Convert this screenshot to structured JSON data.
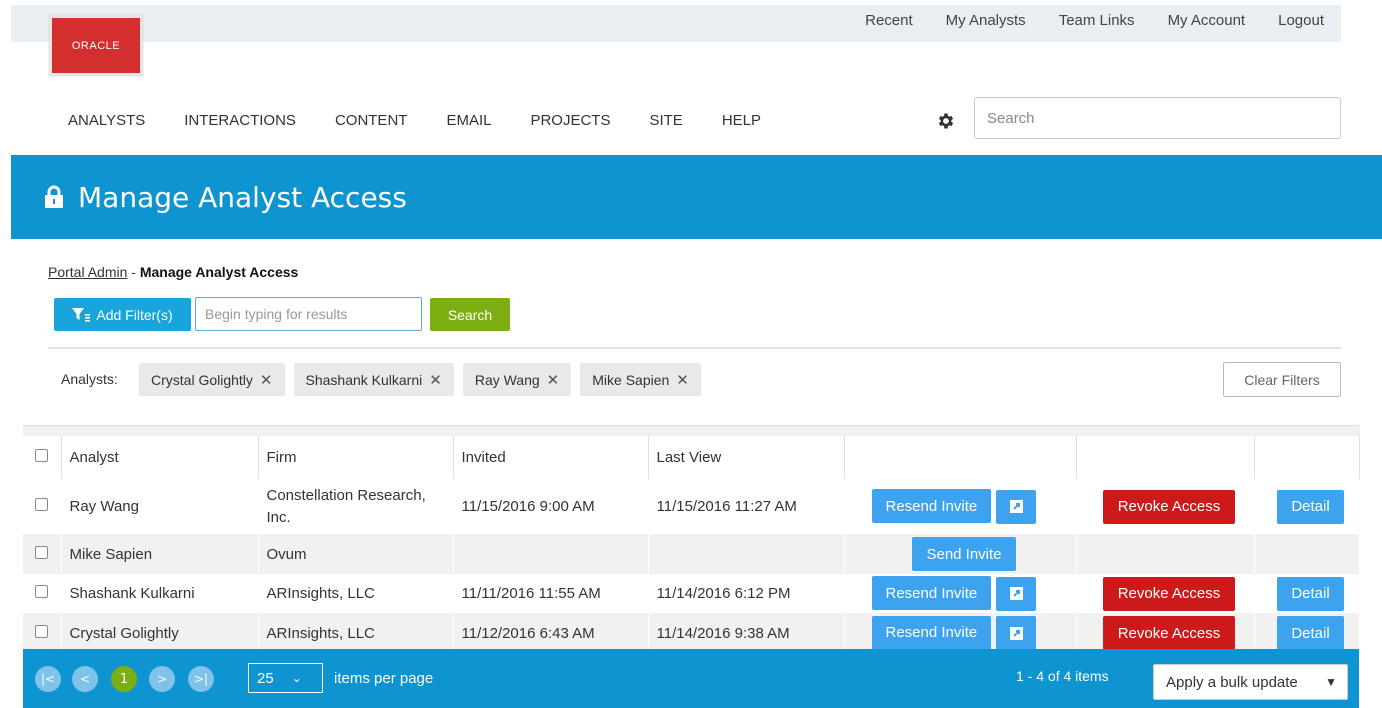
{
  "header": {
    "logo_text": "ORACLE",
    "top_links": [
      "Recent",
      "My Analysts",
      "Team Links",
      "My Account",
      "Logout"
    ],
    "nav": [
      "ANALYSTS",
      "INTERACTIONS",
      "CONTENT",
      "EMAIL",
      "PROJECTS",
      "SITE",
      "HELP"
    ],
    "search_placeholder": "Search"
  },
  "page": {
    "title": "Manage Analyst Access",
    "breadcrumb_link": "Portal Admin",
    "breadcrumb_sep": " - ",
    "breadcrumb_current": "Manage Analyst Access"
  },
  "filters": {
    "add_filter_label": "Add Filter(s)",
    "input_placeholder": "Begin typing for results",
    "search_label": "Search",
    "analysts_label": "Analysts:",
    "chips": [
      "Crystal Golightly",
      "Shashank Kulkarni",
      "Ray Wang",
      "Mike Sapien"
    ],
    "clear_label": "Clear Filters"
  },
  "table": {
    "columns": [
      "Analyst",
      "Firm",
      "Invited",
      "Last View"
    ],
    "rows": [
      {
        "analyst": "Ray Wang",
        "firm": "Constellation Research, Inc.",
        "invited": "11/15/2016 9:00 AM",
        "last_view": "11/15/2016 11:27 AM",
        "invite_label": "Resend Invite",
        "revoke_label": "Revoke Access",
        "detail_label": "Detail"
      },
      {
        "analyst": "Mike Sapien",
        "firm": "Ovum",
        "invited": "",
        "last_view": "",
        "invite_label": "Send Invite",
        "revoke_label": "",
        "detail_label": ""
      },
      {
        "analyst": "Shashank Kulkarni",
        "firm": "ARInsights, LLC",
        "invited": "11/11/2016 11:55 AM",
        "last_view": "11/14/2016 6:12 PM",
        "invite_label": "Resend Invite",
        "revoke_label": "Revoke Access",
        "detail_label": "Detail"
      },
      {
        "analyst": "Crystal Golightly",
        "firm": "ARInsights, LLC",
        "invited": "11/12/2016 6:43 AM",
        "last_view": "11/14/2016 9:38 AM",
        "invite_label": "Resend Invite",
        "revoke_label": "Revoke Access",
        "detail_label": "Detail"
      }
    ]
  },
  "pager": {
    "current_page": "1",
    "page_size": "25",
    "items_per_page_label": "items per page",
    "count_text": "1 - 4 of 4 items",
    "bulk_label": "Apply a bulk update"
  },
  "colors": {
    "brand_blue": "#0f94d2",
    "button_blue": "#3da3ee",
    "revoke_red": "#cc1a1a",
    "search_green": "#7cad11",
    "oracle_red": "#d32f2f"
  },
  "icons": [
    "gear-icon",
    "lock-icon",
    "filter-icon",
    "chip-remove-icon",
    "external-link-icon",
    "first-page-icon",
    "prev-page-icon",
    "next-page-icon",
    "last-page-icon",
    "chevron-down-icon"
  ]
}
